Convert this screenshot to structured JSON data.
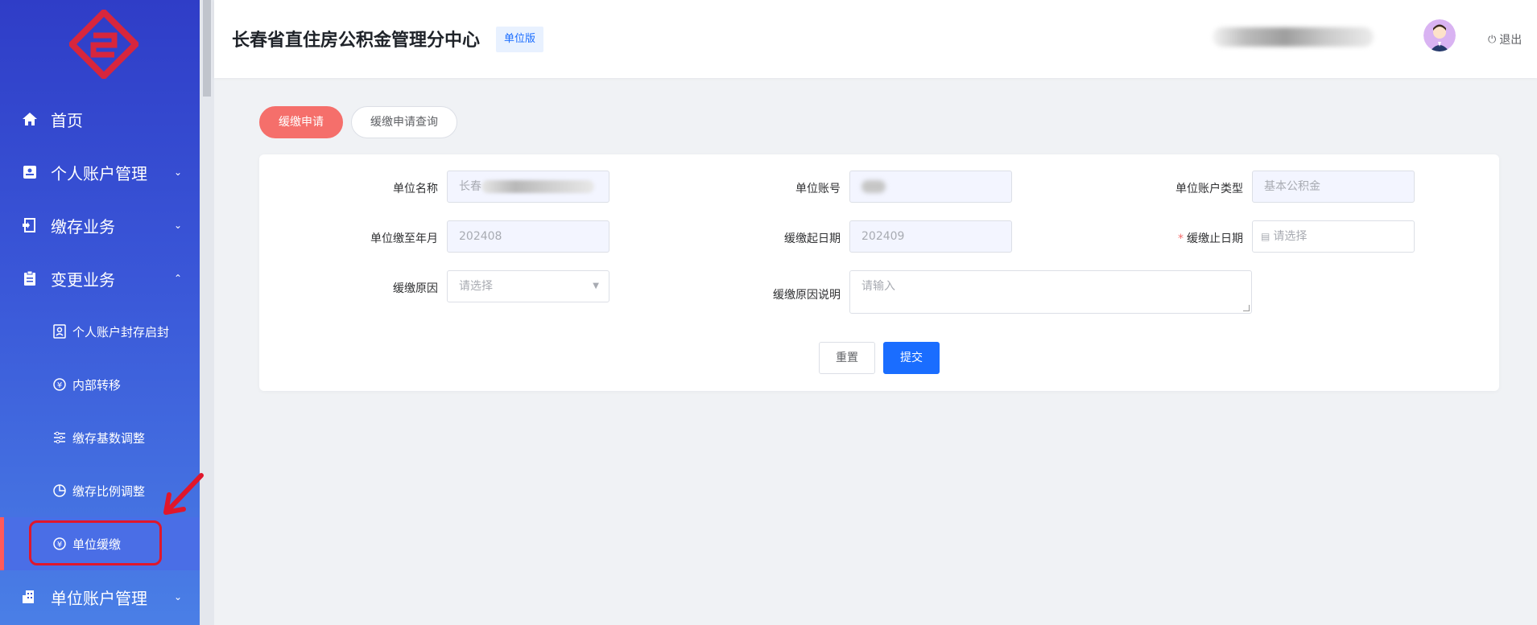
{
  "header": {
    "title": "长春省直住房公积金管理分中心",
    "badge": "单位版",
    "logout_label": "退出"
  },
  "sidebar": {
    "items": [
      {
        "label": "首页",
        "icon": "home-icon",
        "chevron": ""
      },
      {
        "label": "个人账户管理",
        "icon": "id-card-icon",
        "chevron": "⌄"
      },
      {
        "label": "缴存业务",
        "icon": "deposit-icon",
        "chevron": "⌄"
      },
      {
        "label": "变更业务",
        "icon": "clipboard-icon",
        "chevron": "⌃"
      }
    ],
    "sub_items": [
      {
        "label": "个人账户封存启封",
        "icon": "person-card-icon"
      },
      {
        "label": "内部转移",
        "icon": "yuan-transfer-icon"
      },
      {
        "label": "缴存基数调整",
        "icon": "sliders-icon"
      },
      {
        "label": "缴存比例调整",
        "icon": "pie-icon"
      },
      {
        "label": "单位缓缴",
        "icon": "yuan-cycle-icon"
      }
    ],
    "bottom_item": {
      "label": "单位账户管理",
      "icon": "building-icon",
      "chevron": "⌄"
    }
  },
  "tabs": [
    {
      "label": "缓缴申请",
      "active": true
    },
    {
      "label": "缓缴申请查询",
      "active": false
    }
  ],
  "form": {
    "unit_name_label": "单位名称",
    "unit_name_value": "长春",
    "unit_account_label": "单位账号",
    "unit_account_type_label": "单位账户类型",
    "unit_account_type_value": "基本公积金",
    "paid_until_label": "单位缴至年月",
    "paid_until_value": "202408",
    "defer_start_label": "缓缴起日期",
    "defer_start_value": "202409",
    "defer_end_label": "缓缴止日期",
    "defer_end_placeholder": "请选择",
    "reason_label": "缓缴原因",
    "reason_placeholder": "请选择",
    "reason_desc_label": "缓缴原因说明",
    "reason_desc_placeholder": "请输入",
    "reset_label": "重置",
    "submit_label": "提交"
  },
  "colors": {
    "accent": "#1a6dff",
    "tab_active": "#f56f6b",
    "required": "#f56c6c",
    "annotation": "#e0162b"
  }
}
